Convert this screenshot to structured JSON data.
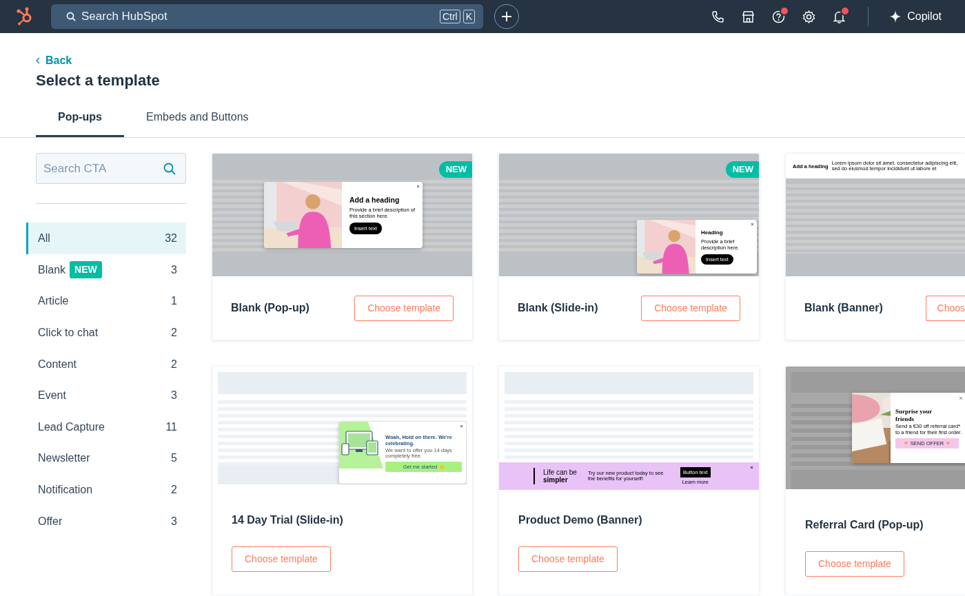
{
  "topbar": {
    "search_placeholder": "Search HubSpot",
    "shortcut_keys": [
      "Ctrl",
      "K"
    ],
    "icons": [
      {
        "kind": "phone",
        "badge": false
      },
      {
        "kind": "store",
        "badge": false
      },
      {
        "kind": "help",
        "badge": true
      },
      {
        "kind": "settings",
        "badge": false
      },
      {
        "kind": "bell",
        "badge": true
      }
    ],
    "copilot": "Copilot"
  },
  "back": "Back",
  "title": "Select a template",
  "tabs": [
    {
      "label": "Pop-ups",
      "selected": true
    },
    {
      "label": "Embeds and Buttons",
      "selected": false
    }
  ],
  "sidebar": {
    "search_placeholder": "Search CTA",
    "categories": [
      {
        "label": "All",
        "count": "32",
        "selected": true
      },
      {
        "label": "Blank",
        "count": "3",
        "selected": false,
        "badge": "NEW"
      },
      {
        "label": "Article",
        "count": "1",
        "selected": false
      },
      {
        "label": "Click to chat",
        "count": "2",
        "selected": false
      },
      {
        "label": "Content",
        "count": "2",
        "selected": false
      },
      {
        "label": "Event",
        "count": "3",
        "selected": false
      },
      {
        "label": "Lead Capture",
        "count": "11",
        "selected": false
      },
      {
        "label": "Newsletter",
        "count": "5",
        "selected": false
      },
      {
        "label": "Notification",
        "count": "2",
        "selected": false
      },
      {
        "label": "Offer",
        "count": "3",
        "selected": false
      }
    ]
  },
  "templates": [
    {
      "name": "Blank (Pop-up)",
      "button": "Choose template",
      "badge": "NEW",
      "kind": "popup",
      "preview": {
        "heading": "Add a heading",
        "description": "Provide a brief description of this section here.",
        "button": "Insert text"
      }
    },
    {
      "name": "Blank (Slide-in)",
      "button": "Choose template",
      "badge": "NEW",
      "kind": "slidein",
      "preview": {
        "heading": "Heading",
        "description": "Provide a brief description here.",
        "button": "Insert text"
      }
    },
    {
      "name": "Blank (Banner)",
      "button": "Choos",
      "kind": "banner",
      "preview": {
        "heading": "Add a heading",
        "description": "Lorem ipsum dolor sit amet, consectetur adipiscing elit, sed do eiusmod tempor incididunt ut labore et"
      }
    },
    {
      "name": "14 Day Trial (Slide-in)",
      "button": "Choose template",
      "kind": "trial",
      "preview": {
        "heading": "Woah, Hold on there. We're celebrating.",
        "description": "We want to offer you 14 days completely free.",
        "button": "Get me started"
      }
    },
    {
      "name": "Product Demo (Banner)",
      "button": "Choose template",
      "kind": "demo",
      "preview": {
        "heading": "Life can be",
        "subheading": "simpler",
        "description": "Try our new product today to see the benefits for yourself!",
        "button": "Button text",
        "link": "Learn more"
      }
    },
    {
      "name": "Referral Card (Pop-up)",
      "button": "Choose template",
      "kind": "referral",
      "preview": {
        "heading": "Surprise your friends",
        "description": "Send a €30 off referral card* to a friend for their first order.",
        "button": "SEND OFFER"
      }
    }
  ]
}
